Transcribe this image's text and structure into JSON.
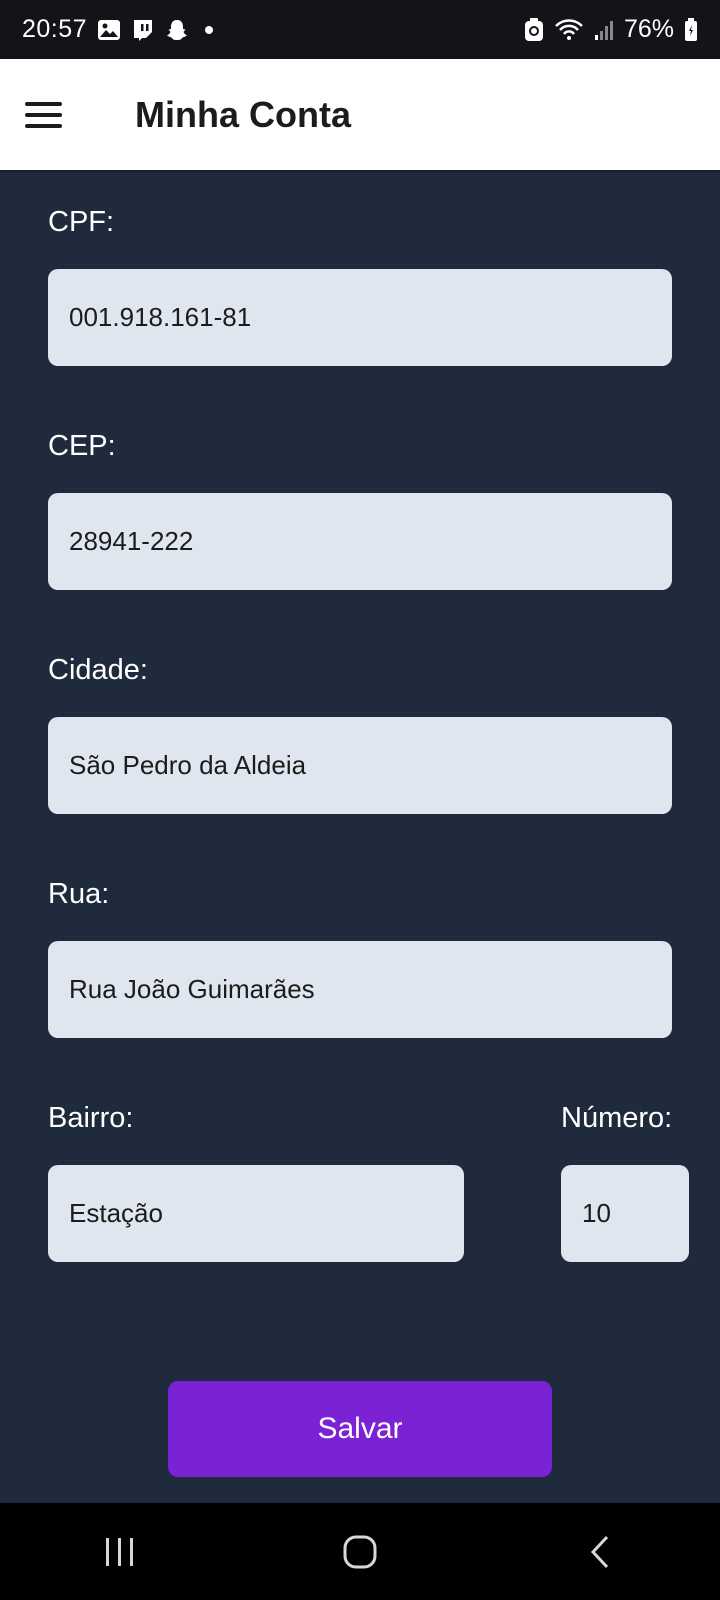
{
  "status_bar": {
    "time": "20:57",
    "battery": "76%",
    "icons": [
      "gallery-icon",
      "twitch-icon",
      "snapchat-icon",
      "notification-dot",
      "recycle-icon",
      "wifi-icon",
      "signal-icon",
      "battery-icon"
    ]
  },
  "app_bar": {
    "title": "Minha Conta",
    "menu_icon": "hamburger-menu-icon"
  },
  "form": {
    "cpf": {
      "label": "CPF:",
      "value": "001.918.161-81"
    },
    "cep": {
      "label": "CEP:",
      "value": "28941-222"
    },
    "cidade": {
      "label": "Cidade:",
      "value": "São Pedro da Aldeia"
    },
    "rua": {
      "label": "Rua:",
      "value": "Rua João Guimarães"
    },
    "bairro": {
      "label": "Bairro:",
      "value": "Estação"
    },
    "numero": {
      "label": "Número:",
      "value": "10"
    }
  },
  "actions": {
    "save_label": "Salvar"
  },
  "nav_bar": {
    "icons": [
      "recent-apps-icon",
      "home-icon",
      "back-icon"
    ]
  },
  "colors": {
    "background": "#1f2a3d",
    "input_background": "#e0e6f0",
    "primary": "#7a22d4",
    "app_bar": "#ffffff"
  }
}
